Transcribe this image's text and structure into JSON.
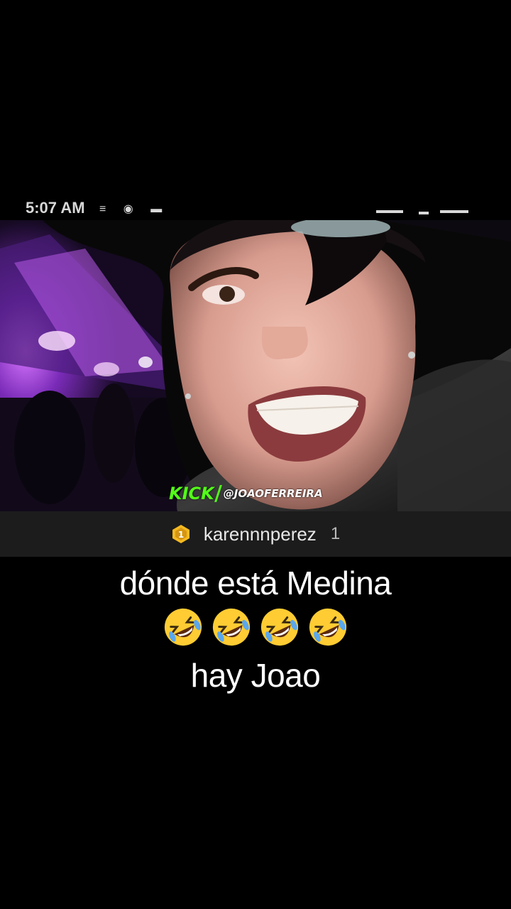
{
  "status_bar": {
    "time": "5:07 AM",
    "left_icons": "≡ ◉ ▬"
  },
  "video": {
    "watermark": {
      "brand": "KICK",
      "handle": "@JOAOFERREIRA"
    }
  },
  "comment": {
    "badge_number": "1",
    "username": "karennnperez",
    "count": "1"
  },
  "caption": {
    "line1": "dónde está Medina",
    "emoji_name": "rolling-on-the-floor-laughing",
    "emoji_count": 4,
    "line3": "hay Joao"
  },
  "colors": {
    "kick_green": "#53fc18",
    "comment_bg": "#1c1c1c",
    "badge_gold": "#f5b921"
  }
}
